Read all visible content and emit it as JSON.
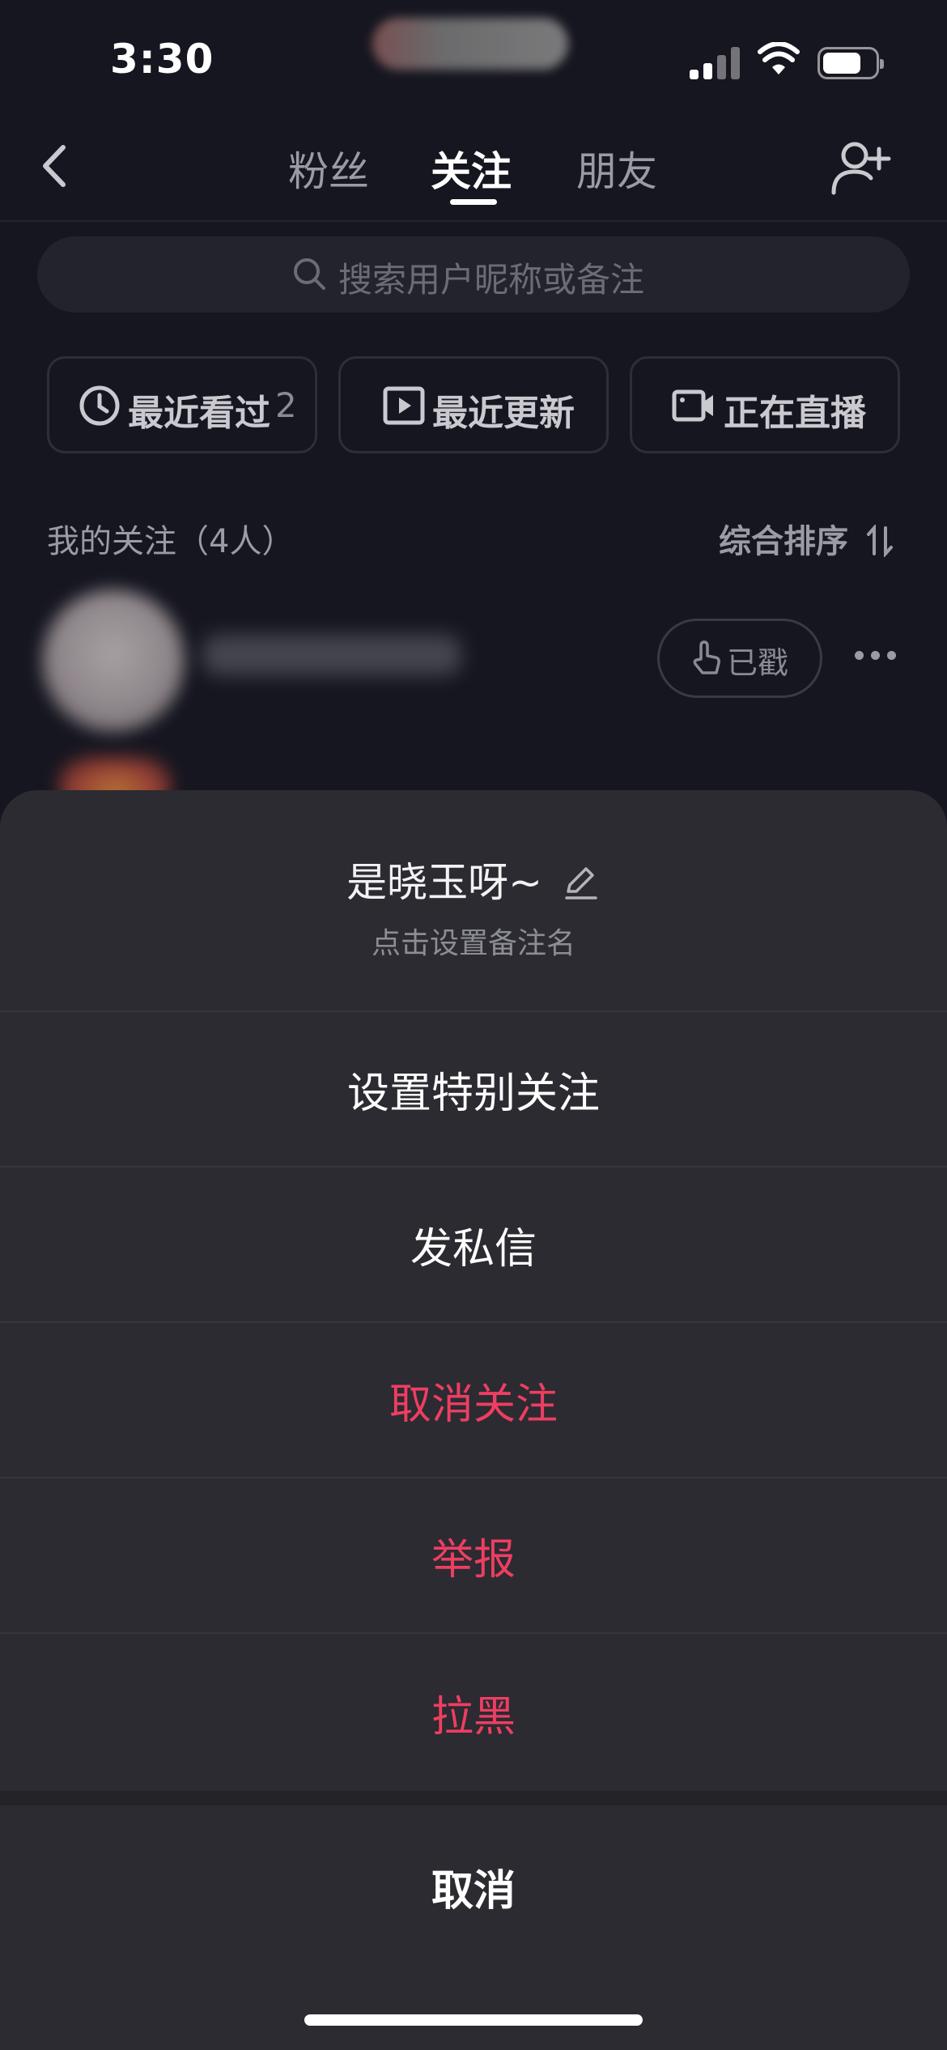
{
  "status_bar": {
    "time": "3:30",
    "icons": [
      "cellular-signal-icon",
      "wifi-icon",
      "battery-icon"
    ]
  },
  "nav": {
    "tabs": [
      {
        "label": "粉丝",
        "active": false
      },
      {
        "label": "关注",
        "active": true
      },
      {
        "label": "朋友",
        "active": false
      }
    ],
    "icons": [
      "back-chevron-icon",
      "add-user-icon"
    ]
  },
  "search": {
    "placeholder": "搜索用户昵称或备注"
  },
  "filters": [
    {
      "icon": "clock-icon",
      "label": "最近看过",
      "count": "2"
    },
    {
      "icon": "play-square-icon",
      "label": "最近更新"
    },
    {
      "icon": "video-camera-icon",
      "label": "正在直播"
    }
  ],
  "following": {
    "title": "我的关注（4人）",
    "sort_label": "综合排序",
    "sort_icon": "sort-arrows-icon",
    "rows": [
      {
        "followed_label": "已戳",
        "followed_icon": "poke-finger-icon"
      }
    ]
  },
  "sheet": {
    "user_name": "是晓玉呀~",
    "edit_icon": "pencil-icon",
    "subtitle": "点击设置备注名",
    "actions": [
      {
        "label": "设置特别关注",
        "danger": false
      },
      {
        "label": "发私信",
        "danger": false
      },
      {
        "label": "取消关注",
        "danger": true
      },
      {
        "label": "举报",
        "danger": true
      },
      {
        "label": "拉黑",
        "danger": true
      }
    ],
    "cancel_label": "取消"
  },
  "colors": {
    "background": "#161620",
    "sheet": "#2b2b31",
    "danger": "#ee3e62",
    "muted_text": "#9b9ba3"
  }
}
